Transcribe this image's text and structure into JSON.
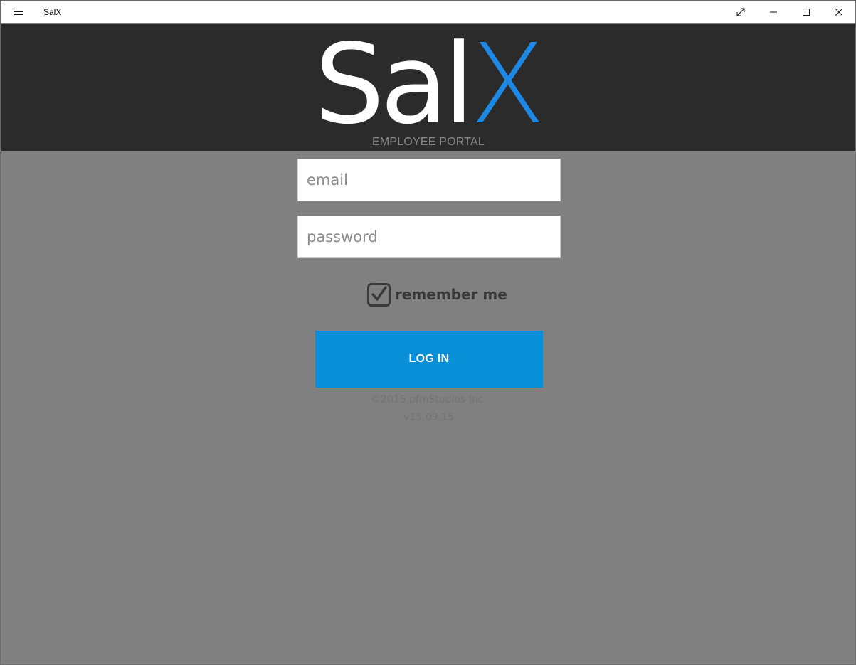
{
  "window": {
    "title": "SalX",
    "controls": [
      "fullscreen-icon",
      "minimize-icon",
      "maximize-icon",
      "close-icon"
    ]
  },
  "header": {
    "logo_part1": "Sal",
    "logo_part2": "X",
    "subtitle": "EMPLOYEE PORTAL"
  },
  "form": {
    "email_placeholder": "email",
    "email_value": "",
    "password_placeholder": "password",
    "password_value": "",
    "remember_label": "remember me",
    "remember_checked": true,
    "login_label": "LOG IN"
  },
  "footer": {
    "copyright": "©2015 pfmStudios Inc.",
    "version": "v15.09.15"
  },
  "colors": {
    "accent": "#1e88e5",
    "login_button": "#0a8fd9",
    "header_bg": "#2b2b2b",
    "page_bg": "#808080"
  }
}
